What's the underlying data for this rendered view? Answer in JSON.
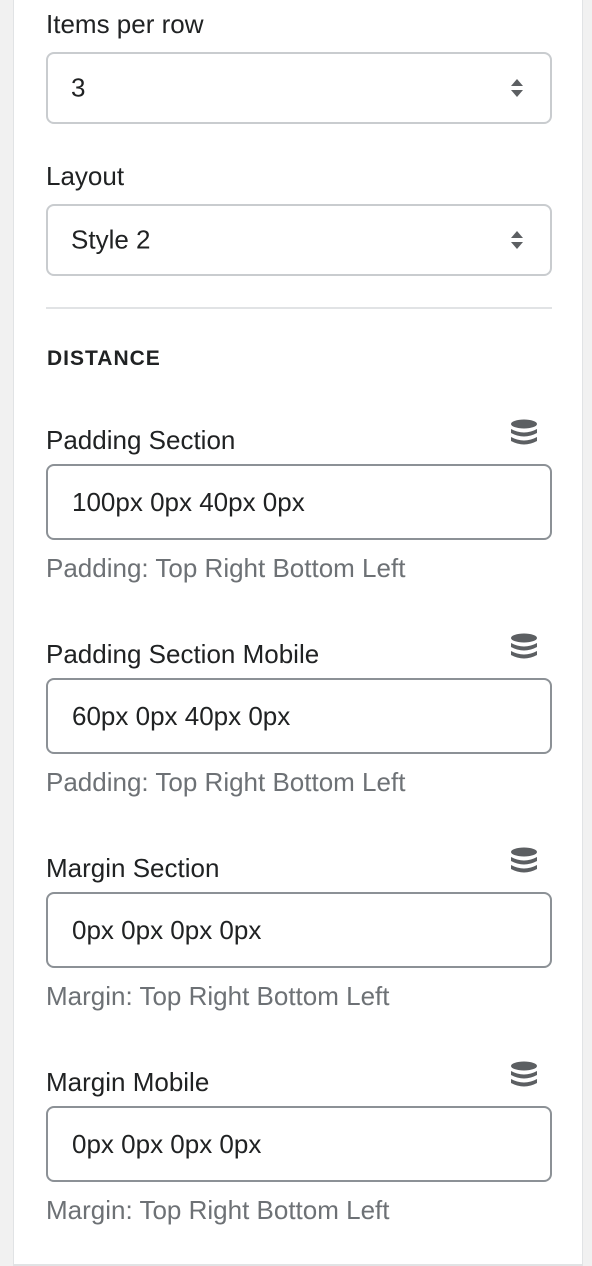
{
  "settings": {
    "items_per_row": {
      "label": "Items per row",
      "value": "3"
    },
    "layout": {
      "label": "Layout",
      "value": "Style 2"
    }
  },
  "distance": {
    "heading": "DISTANCE",
    "fields": [
      {
        "label": "Padding Section",
        "value": "100px 0px 40px 0px",
        "help": "Padding: Top Right Bottom Left",
        "icon": "database-icon"
      },
      {
        "label": "Padding Section Mobile",
        "value": "60px 0px 40px 0px",
        "help": "Padding: Top Right Bottom Left",
        "icon": "database-icon"
      },
      {
        "label": "Margin Section",
        "value": "0px 0px 0px 0px",
        "help": "Margin: Top Right Bottom Left",
        "icon": "database-icon"
      },
      {
        "label": "Margin Mobile",
        "value": "0px 0px 0px 0px",
        "help": "Margin: Top Right Bottom Left",
        "icon": "database-icon"
      }
    ]
  },
  "colors": {
    "text": "#202223",
    "muted": "#6d7175",
    "border": "#8c9196",
    "icon": "#5c5f62"
  }
}
